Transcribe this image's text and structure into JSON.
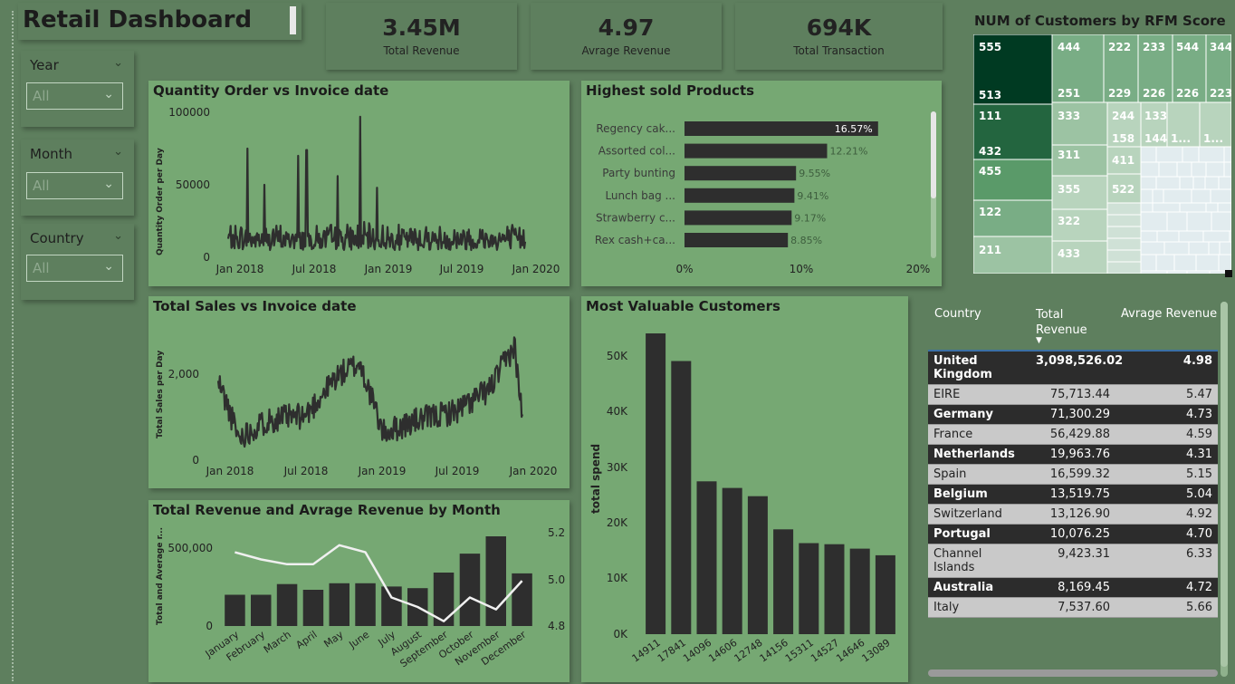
{
  "header": {
    "title": "Retail Dashboard"
  },
  "kpis": [
    {
      "value": "3.45M",
      "label": "Total Revenue"
    },
    {
      "value": "4.97",
      "label": "Avrage Revenue"
    },
    {
      "value": "694K",
      "label": "Total Transaction"
    }
  ],
  "slicers": [
    {
      "label": "Year",
      "value": "All"
    },
    {
      "label": "Month",
      "value": "All"
    },
    {
      "label": "Country",
      "value": "All"
    }
  ],
  "charts": {
    "quantity": {
      "title": "Quantity Order vs Invoice date",
      "ylabel": "Quantity Order per Day",
      "yticks": [
        "100000",
        "50000",
        "0"
      ],
      "xticks": [
        "Jan 2018",
        "Jul 2018",
        "Jan 2019",
        "Jul 2019",
        "Jan 2020"
      ]
    },
    "products": {
      "title": "Highest sold Products",
      "xticks": [
        "0%",
        "10%",
        "20%"
      ]
    },
    "sales": {
      "title": "Total Sales vs Invoice date",
      "ylabel": "Total Sales per Day",
      "yticks": [
        "2,000",
        "0"
      ],
      "xticks": [
        "Jan 2018",
        "Jul 2018",
        "Jan 2019",
        "Jul 2019",
        "Jan 2020"
      ]
    },
    "monthly": {
      "title": "Total Revenue and Avrage Revenue by Month",
      "ylabel": "Total and Average r...",
      "yticks_left": [
        "500,000",
        "0"
      ],
      "yticks_right": [
        "5.2",
        "5.0",
        "4.8"
      ]
    },
    "customers": {
      "title": "Most Valuable Customers",
      "ylabel": "total spend",
      "yticks": [
        "50K",
        "40K",
        "30K",
        "20K",
        "10K",
        "0K"
      ]
    },
    "rfm": {
      "title": "NUM of Customers by RFM Score"
    }
  },
  "chart_data": [
    {
      "type": "line",
      "title": "Quantity Order vs Invoice date",
      "ylabel": "Quantity Order per Day",
      "x_range": [
        "2017-12-01",
        "2019-12-09"
      ],
      "ylim": [
        0,
        100000
      ],
      "x_ticks": [
        "Jan 2018",
        "Jul 2018",
        "Jan 2019",
        "Jul 2019",
        "Jan 2020"
      ],
      "typical_daily_range": [
        5000,
        25000
      ],
      "spikes": [
        {
          "x": "2018-01-18",
          "y": 75000
        },
        {
          "x": "2018-03-01",
          "y": 50000
        },
        {
          "x": "2018-05-24",
          "y": 70000
        },
        {
          "x": "2018-06-14",
          "y": 74000
        },
        {
          "x": "2018-08-30",
          "y": 56000
        },
        {
          "x": "2018-10-25",
          "y": 97000
        },
        {
          "x": "2018-12-06",
          "y": 48000
        }
      ]
    },
    {
      "type": "bar",
      "title": "Highest sold Products",
      "orientation": "horizontal",
      "categories": [
        "Regency cak...",
        "Assorted col...",
        "Party bunting",
        "Lunch bag ...",
        "Strawberry c...",
        "Rex cash+ca..."
      ],
      "values": [
        16.57,
        12.21,
        9.55,
        9.41,
        9.17,
        8.85
      ],
      "labels": [
        "16.57%",
        "12.21%",
        "9.55%",
        "9.41%",
        "9.17%",
        "8.85%"
      ],
      "xlim": [
        0,
        20
      ],
      "x_ticks": [
        "0%",
        "10%",
        "20%"
      ]
    },
    {
      "type": "line",
      "title": "Total Sales vs Invoice date",
      "ylabel": "Total Sales per Day",
      "x_range": [
        "2017-12-01",
        "2019-12-09"
      ],
      "ylim": [
        0,
        3000
      ],
      "x_ticks": [
        "Jan 2018",
        "Jul 2018",
        "Jan 2019",
        "Jul 2019",
        "Jan 2020"
      ],
      "trend": [
        {
          "x": "2017-12-05",
          "y": 1700
        },
        {
          "x": "2018-01-20",
          "y": 500
        },
        {
          "x": "2018-04-01",
          "y": 900
        },
        {
          "x": "2018-07-01",
          "y": 1000
        },
        {
          "x": "2018-09-15",
          "y": 1900
        },
        {
          "x": "2018-11-10",
          "y": 2200
        },
        {
          "x": "2019-01-05",
          "y": 600
        },
        {
          "x": "2019-04-01",
          "y": 900
        },
        {
          "x": "2019-07-01",
          "y": 1100
        },
        {
          "x": "2019-09-20",
          "y": 1600
        },
        {
          "x": "2019-11-20",
          "y": 2600
        },
        {
          "x": "2019-12-09",
          "y": 900
        }
      ]
    },
    {
      "type": "bar",
      "title": "Total Revenue and Avrage Revenue by Month",
      "ylabel": "Total and Average r...",
      "categories": [
        "January",
        "February",
        "March",
        "April",
        "May",
        "June",
        "July",
        "August",
        "September",
        "October",
        "November",
        "December"
      ],
      "series": [
        {
          "values": [
            190000,
            190000,
            255000,
            220000,
            260000,
            260000,
            240000,
            230000,
            325000,
            440000,
            545000,
            320000
          ]
        },
        {
          "type": "line",
          "values": [
            5.11,
            5.08,
            5.06,
            5.06,
            5.14,
            5.11,
            4.92,
            4.88,
            4.82,
            4.92,
            4.87,
            4.99
          ]
        }
      ],
      "ylim": [
        0,
        600000
      ],
      "ylim_right": [
        4.8,
        5.2
      ]
    },
    {
      "type": "bar",
      "title": "Most Valuable Customers",
      "ylabel": "total spend",
      "categories": [
        "14911",
        "17841",
        "14096",
        "14606",
        "12748",
        "14156",
        "15311",
        "14527",
        "14646",
        "13089"
      ],
      "values": [
        54500,
        49500,
        27700,
        26500,
        25000,
        19000,
        16500,
        16300,
        15500,
        14300
      ],
      "ylim": [
        0,
        55000
      ]
    }
  ],
  "rfm": {
    "scores": [
      "555",
      "513",
      "111",
      "432",
      "455",
      "122",
      "211",
      "444",
      "251",
      "222",
      "229",
      "233",
      "226",
      "544",
      "226",
      "344",
      "223",
      "333",
      "311",
      "355",
      "322",
      "433",
      "244",
      "158",
      "133",
      "144",
      "1...",
      "1...",
      "411",
      "522"
    ],
    "shades": {
      "c1": "#003a22",
      "c2": "#23653f",
      "c3": "#5a9a69",
      "c4": "#79ad85",
      "c5": "#9cc3a3",
      "c6": "#b8d4bd",
      "c7": "#cfe1d6",
      "c8": "#e2ecef"
    }
  },
  "table": {
    "headers": {
      "country": "Country",
      "total_revenue": "Total Revenue",
      "avg_revenue": "Avrage Revenue"
    },
    "rows": [
      {
        "country": "United Kingdom",
        "total": "3,098,526.02",
        "avg": "4.98"
      },
      {
        "country": "EIRE",
        "total": "75,713.44",
        "avg": "5.47"
      },
      {
        "country": "Germany",
        "total": "71,300.29",
        "avg": "4.73"
      },
      {
        "country": "France",
        "total": "56,429.88",
        "avg": "4.59"
      },
      {
        "country": "Netherlands",
        "total": "19,963.76",
        "avg": "4.31"
      },
      {
        "country": "Spain",
        "total": "16,599.32",
        "avg": "5.15"
      },
      {
        "country": "Belgium",
        "total": "13,519.75",
        "avg": "5.04"
      },
      {
        "country": "Switzerland",
        "total": "13,126.90",
        "avg": "4.92"
      },
      {
        "country": "Portugal",
        "total": "10,076.25",
        "avg": "4.70"
      },
      {
        "country": "Channel Islands",
        "total": "9,423.31",
        "avg": "6.33"
      },
      {
        "country": "Australia",
        "total": "8,169.45",
        "avg": "4.72"
      },
      {
        "country": "Italy",
        "total": "7,537.60",
        "avg": "5.66"
      }
    ]
  },
  "colors": {
    "background": "#5e7f5e",
    "panel": "#76a873",
    "bar": "#2e2e2e",
    "line": "#2e2e2e",
    "avg_line": "#f0f0f0"
  }
}
